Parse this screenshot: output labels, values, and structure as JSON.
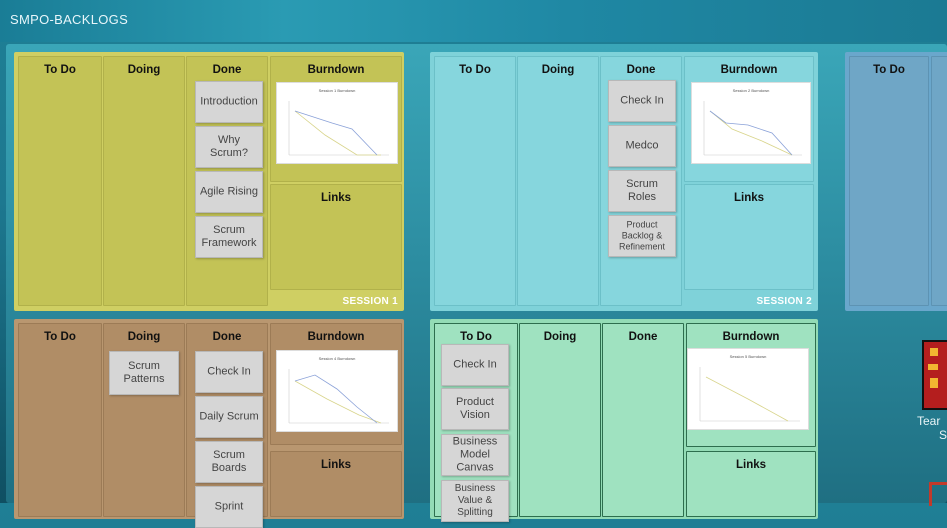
{
  "board": {
    "title": "SMPO-BACKLOGS"
  },
  "columns": {
    "todo": "To Do",
    "doing": "Doing",
    "done": "Done",
    "burndown": "Burndown",
    "links": "Links"
  },
  "sessions": [
    {
      "label": "SESSION 1",
      "chart_title": "Session 1 Burndown",
      "doing": [],
      "done": [
        "Introduction",
        "Why Scrum?",
        "Agile Rising",
        "Scrum Framework"
      ]
    },
    {
      "label": "SESSION 2",
      "chart_title": "Session 2 Burndown",
      "doing": [],
      "done": [
        "Check In",
        "Medco",
        "Scrum Roles",
        "Product Backlog & Refinement"
      ]
    },
    {
      "label": "",
      "chart_title": "Session 4 Burndown",
      "doing": [
        "Scrum Patterns"
      ],
      "done": [
        "Check In",
        "Daily Scrum",
        "Scrum Boards",
        "Sprint"
      ]
    },
    {
      "label": "",
      "chart_title": "Session 5 Burndown",
      "doing": [],
      "todo": [
        "Check In",
        "Product Vision",
        "Business Model Canvas",
        "Business Value & Splitting"
      ]
    }
  ],
  "sidebar": {
    "text_line1": "Tear",
    "text_line2": "S"
  },
  "colors": {
    "session1": "#cfcf63",
    "session2": "#7fd2d9",
    "session3": "#6aa7cc",
    "session4": "#b99770",
    "session5": "#93dcb6"
  }
}
